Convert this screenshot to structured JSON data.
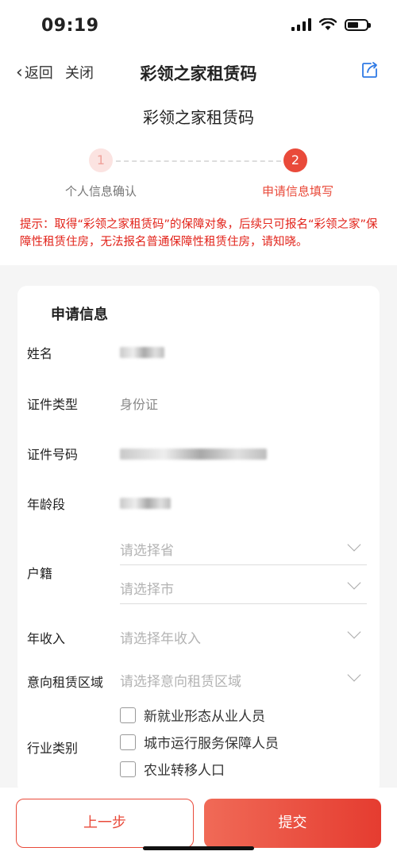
{
  "status": {
    "time": "09:19"
  },
  "nav": {
    "back_label": "返回",
    "close_label": "关闭",
    "title": "彩领之家租赁码"
  },
  "page": {
    "title": "彩领之家租赁码"
  },
  "steps": [
    {
      "num": "1",
      "label": "个人信息确认",
      "state": "done"
    },
    {
      "num": "2",
      "label": "申请信息填写",
      "state": "active"
    }
  ],
  "notice": "提示：取得“彩领之家租赁码”的保障对象，后续只可报名“彩领之家”保障性租赁住房，无法报名普通保障性租赁住房，请知晓。",
  "form": {
    "section_title": "申请信息",
    "name_label": "姓名",
    "id_type_label": "证件类型",
    "id_type_value": "身份证",
    "id_no_label": "证件号码",
    "age_label": "年龄段",
    "hukou_label": "户籍",
    "province_placeholder": "请选择省",
    "city_placeholder": "请选择市",
    "income_label": "年收入",
    "income_placeholder": "请选择年收入",
    "area_label": "意向租赁区域",
    "area_placeholder": "请选择意向租赁区域",
    "industry_label": "行业类别",
    "industry_options": [
      "新就业形态从业人员",
      "城市运行服务保障人员",
      "农业转移人口"
    ]
  },
  "buttons": {
    "prev": "上一步",
    "submit": "提交"
  },
  "colors": {
    "accent": "#e94a3a",
    "notice": "#e2231a",
    "link": "#2f7ae5"
  }
}
